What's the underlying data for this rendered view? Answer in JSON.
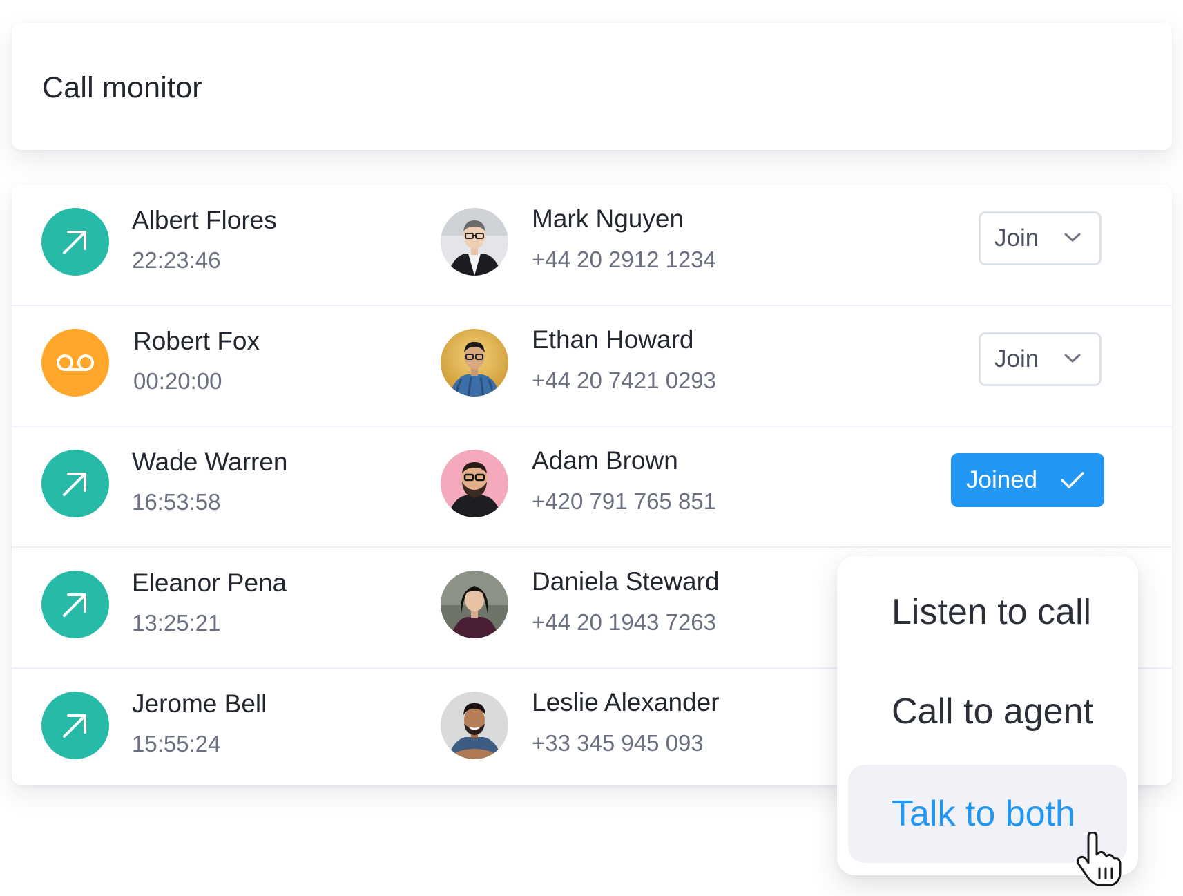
{
  "header": {
    "title": "Call monitor"
  },
  "calls": [
    {
      "status_icon": "outgoing-call-arrow-icon",
      "caller_name": "Albert Flores",
      "time": "22:23:46",
      "agent_name": "Mark Nguyen",
      "agent_phone": "+44 20 2912 1234",
      "action_label": "Join",
      "action_icon": "chevron-down-icon"
    },
    {
      "status_icon": "voicemail-icon",
      "caller_name": "Robert Fox",
      "time": "00:20:00",
      "agent_name": "Ethan Howard",
      "agent_phone": "+44 20 7421 0293",
      "action_label": "Join",
      "action_icon": "chevron-down-icon"
    },
    {
      "status_icon": "outgoing-call-arrow-icon",
      "caller_name": "Wade Warren",
      "time": "16:53:58",
      "agent_name": "Adam Brown",
      "agent_phone": "+420 791 765 851",
      "action_label": "Joined",
      "action_icon": "checkmark-icon"
    },
    {
      "status_icon": "outgoing-call-arrow-icon",
      "caller_name": "Eleanor Pena",
      "time": "13:25:21",
      "agent_name": "Daniela Steward",
      "agent_phone": "+44 20 1943 7263"
    },
    {
      "status_icon": "outgoing-call-arrow-icon",
      "caller_name": "Jerome Bell",
      "time": "15:55:24",
      "agent_name": "Leslie Alexander",
      "agent_phone": "+33 345 945 093"
    }
  ],
  "dropdown": {
    "items": [
      {
        "label": "Listen to call",
        "active": false
      },
      {
        "label": "Call to agent",
        "active": false
      },
      {
        "label": "Talk to both",
        "active": true
      }
    ]
  },
  "colors": {
    "outgoing_icon_bg": "#27bba7",
    "voicemail_icon_bg": "#ffa62b",
    "primary_blue": "#2196f3",
    "text_dark": "#22262e",
    "text_muted": "#6b7180",
    "divider": "#eceef8"
  }
}
